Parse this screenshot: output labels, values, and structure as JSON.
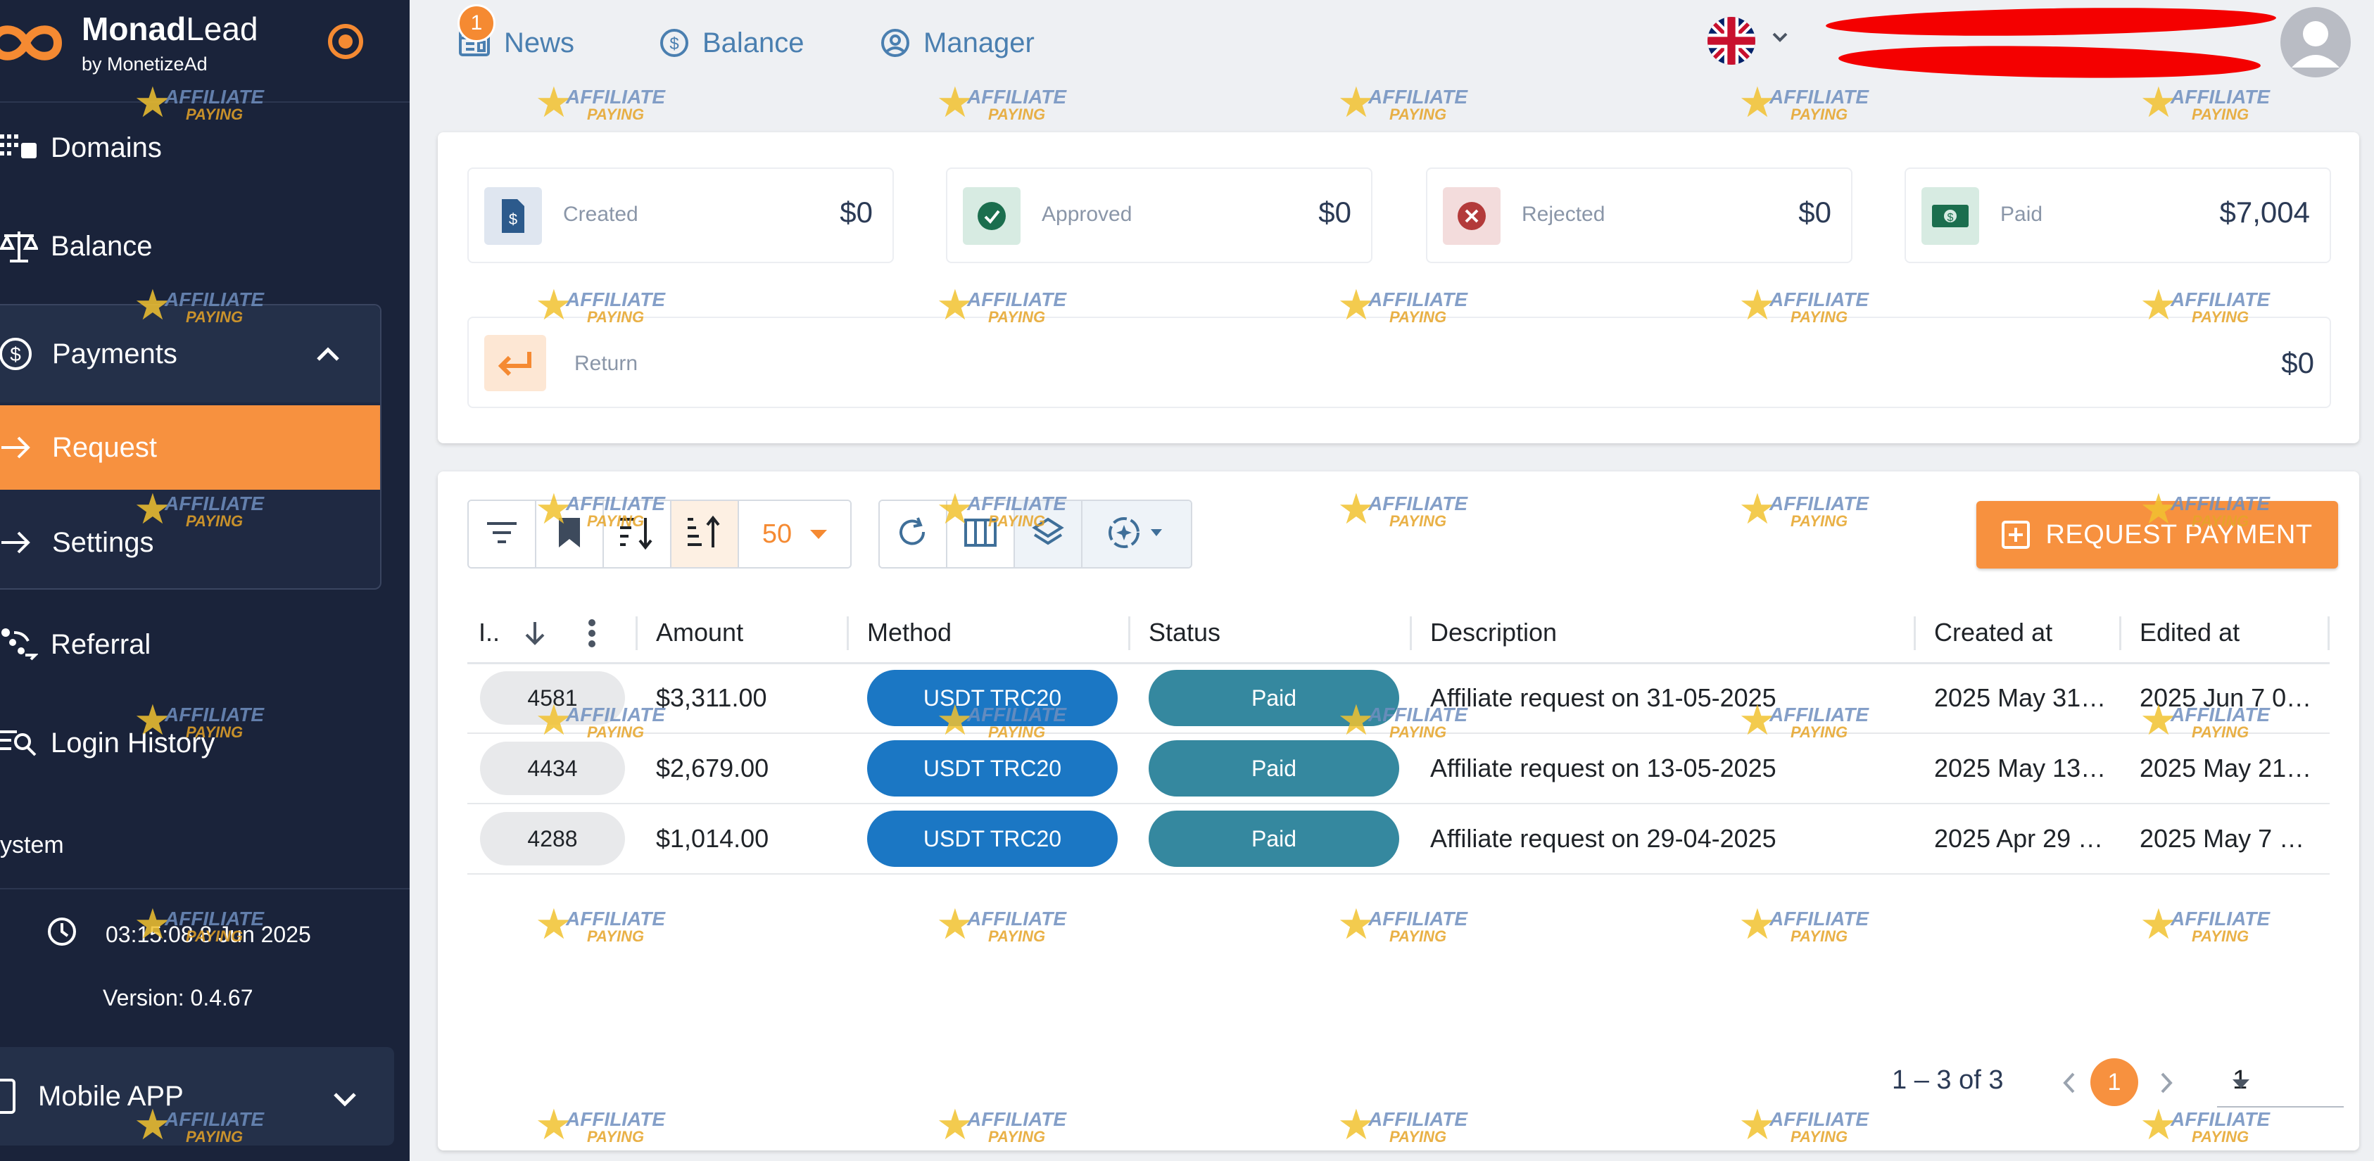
{
  "sidebar": {
    "brand": {
      "name_bold": "Monad",
      "name_rest": "Lead",
      "by": "by MonetizeAd"
    },
    "items": {
      "domains": "Domains",
      "balance": "Balance",
      "payments": "Payments",
      "request": "Request",
      "settings": "Settings",
      "referral": "Referral",
      "login_history": "Login History"
    },
    "system_label": "ystem",
    "clock": "03:15:08 8 Jun 2025",
    "version": "Version: 0.4.67",
    "mobile_app": "Mobile APP"
  },
  "topbar": {
    "news": {
      "label": "News",
      "badge": "1"
    },
    "balance": "Balance",
    "manager": "Manager",
    "language_icon": "uk-flag-icon"
  },
  "summary": {
    "created": {
      "label": "Created",
      "value": "$0"
    },
    "approved": {
      "label": "Approved",
      "value": "$0"
    },
    "rejected": {
      "label": "Rejected",
      "value": "$0"
    },
    "paid": {
      "label": "Paid",
      "value": "$7,004"
    },
    "return": {
      "label": "Return",
      "value": "$0"
    }
  },
  "toolbar": {
    "page_size": "50",
    "request_payment": "REQUEST PAYMENT"
  },
  "table": {
    "headers": {
      "id": "I..",
      "amount": "Amount",
      "method": "Method",
      "status": "Status",
      "description": "Description",
      "created_at": "Created at",
      "edited_at": "Edited at"
    },
    "rows": [
      {
        "id": "4581",
        "amount": "$3,311.00",
        "method": "USDT TRC20",
        "status": "Paid",
        "description": "Affiliate request on 31-05-2025",
        "created_at": "2025 May 31…",
        "edited_at": "2025 Jun 7 0…"
      },
      {
        "id": "4434",
        "amount": "$2,679.00",
        "method": "USDT TRC20",
        "status": "Paid",
        "description": "Affiliate request on 13-05-2025",
        "created_at": "2025 May 13…",
        "edited_at": "2025 May 21…"
      },
      {
        "id": "4288",
        "amount": "$1,014.00",
        "method": "USDT TRC20",
        "status": "Paid",
        "description": "Affiliate request on 29-04-2025",
        "created_at": "2025 Apr 29 …",
        "edited_at": "2025 May 7 …"
      }
    ]
  },
  "pagination": {
    "range": "1 – 3 of 3",
    "current_page": "1",
    "page_select": "1"
  },
  "watermark": {
    "line1": "AFFILIATE",
    "line2": "PAYING"
  },
  "colors": {
    "sidebar_bg": "#1a233a",
    "accent": "#f7913f",
    "method_pill": "#1b77c4",
    "status_pill": "#35889f",
    "link": "#4a7fb0"
  }
}
